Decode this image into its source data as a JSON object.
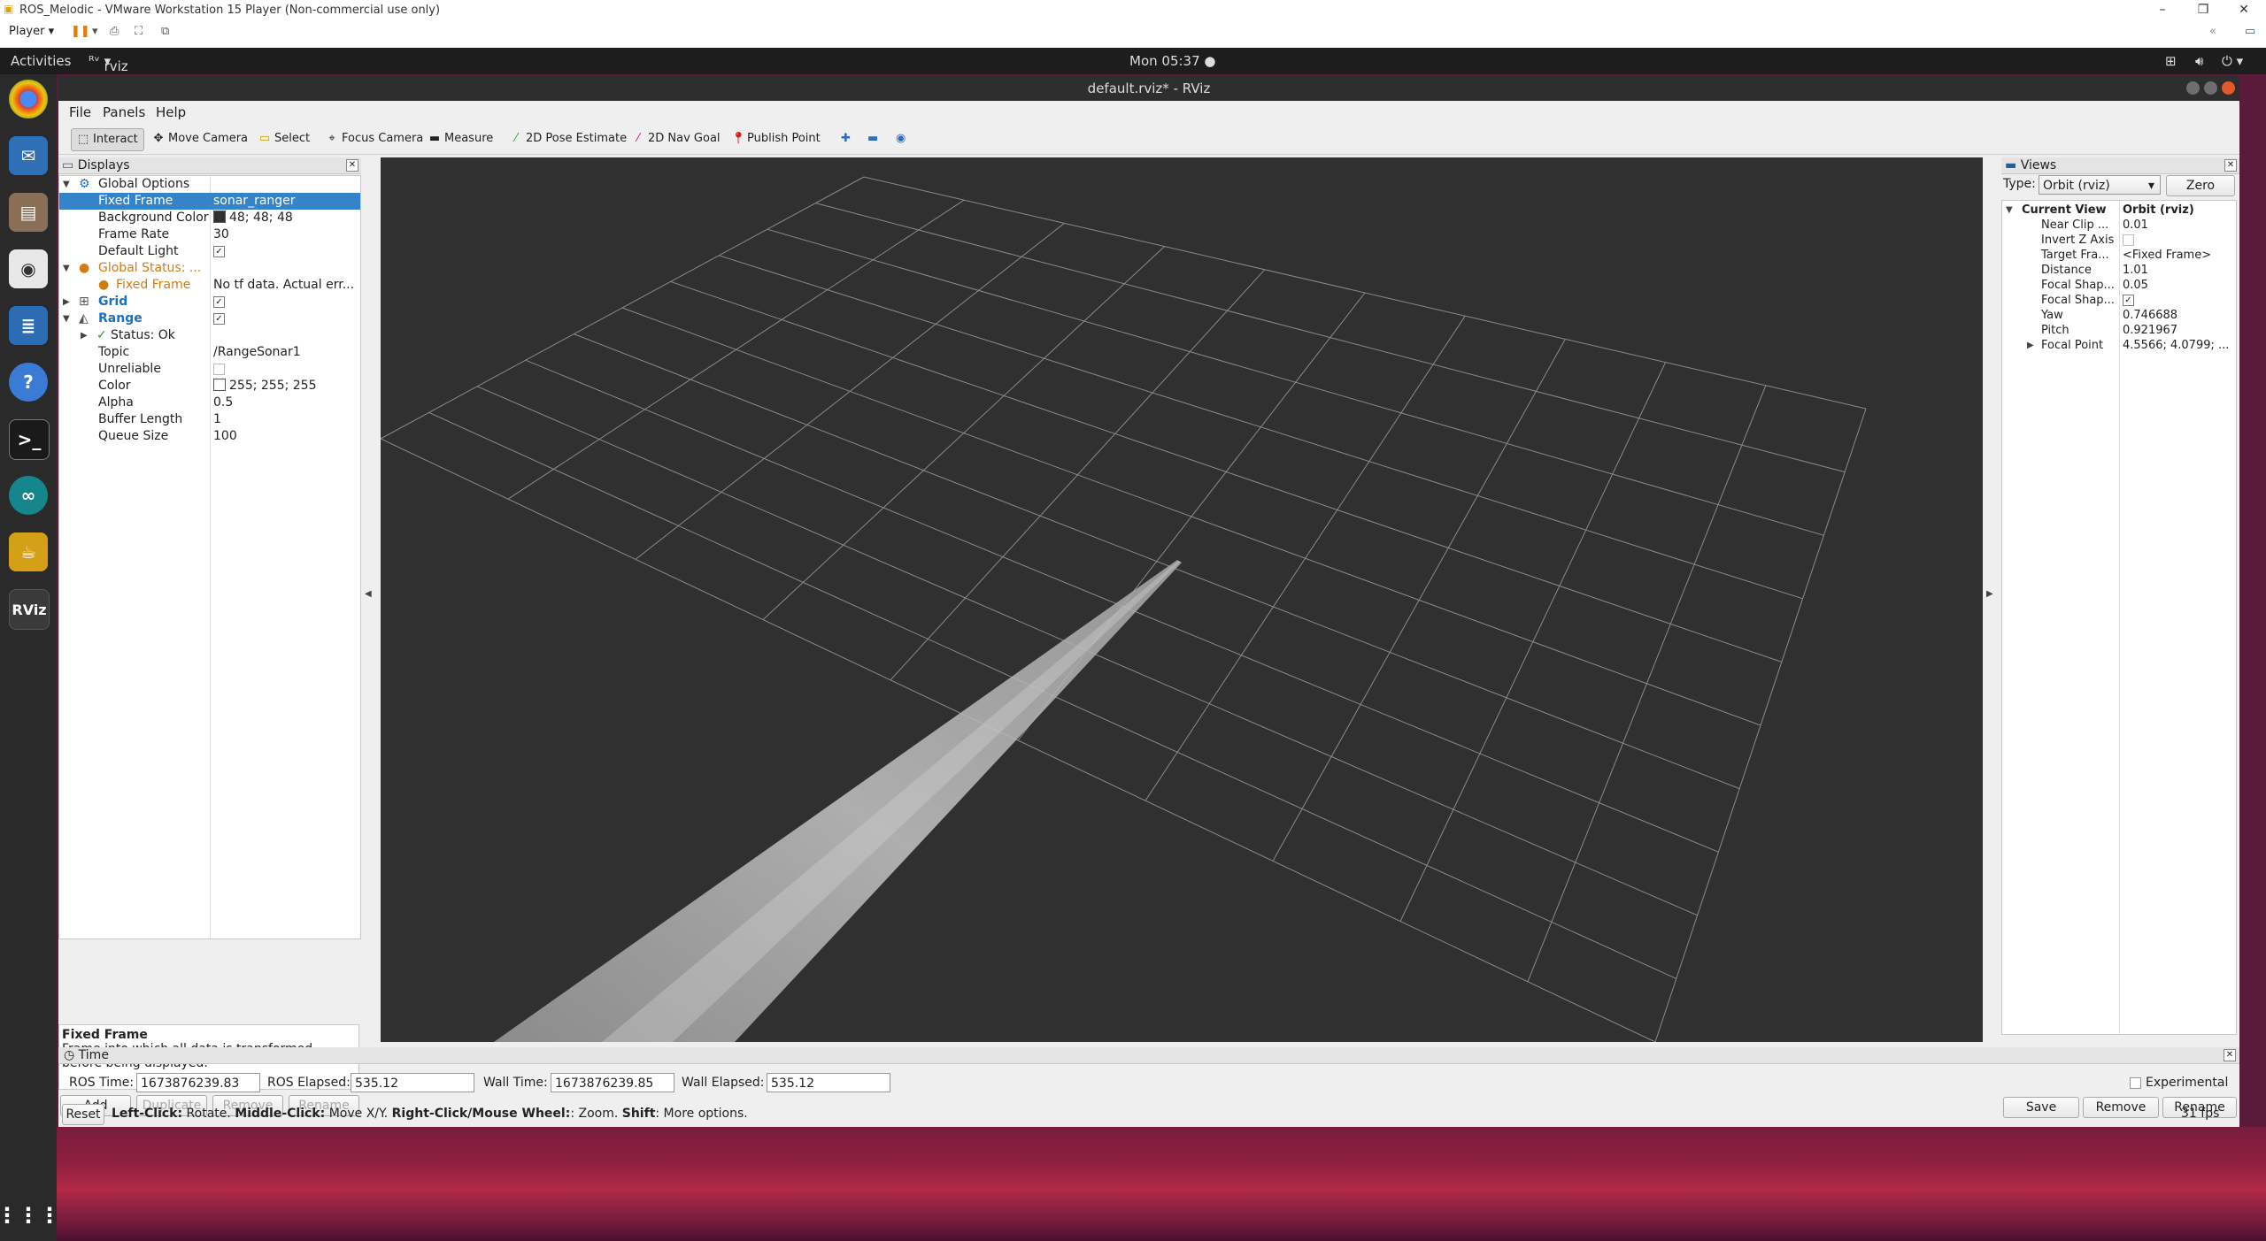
{
  "host": {
    "title": "ROS_Melodic - VMware Workstation 15 Player (Non-commercial use only)",
    "player_menu": "Player",
    "window_controls": [
      "–",
      "❐",
      "✕"
    ]
  },
  "gnome": {
    "activities": "Activities",
    "app_menu": "rviz",
    "clock": "Mon 05:37 ●"
  },
  "dock": {
    "apps": [
      "chrome-icon",
      "thunderbird-icon",
      "files-icon",
      "rhythmbox-icon",
      "writer-icon",
      "help-icon",
      "terminal-icon",
      "arduino-icon",
      "teapot-icon",
      "rviz-icon"
    ],
    "rviz_label": "RViz"
  },
  "rviz": {
    "window_title": "default.rviz* - RViz",
    "menu": {
      "file": "File",
      "panels": "Panels",
      "help": "Help"
    },
    "toolbar": {
      "interact": "Interact",
      "move_camera": "Move Camera",
      "select": "Select",
      "focus_camera": "Focus Camera",
      "measure": "Measure",
      "pose_estimate": "2D Pose Estimate",
      "nav_goal": "2D Nav Goal",
      "publish_point": "Publish Point"
    },
    "displays": {
      "title": "Displays",
      "rows": [
        {
          "key": "Global Options"
        },
        {
          "key": "Fixed Frame",
          "value": "sonar_ranger"
        },
        {
          "key": "Background Color",
          "value": "48; 48; 48"
        },
        {
          "key": "Frame Rate",
          "value": "30"
        },
        {
          "key": "Default Light"
        },
        {
          "key": "Global Status: ..."
        },
        {
          "key": "Fixed Frame",
          "value": "No tf data.  Actual err..."
        },
        {
          "key": "Grid"
        },
        {
          "key": "Range"
        },
        {
          "key": "Status: Ok"
        },
        {
          "key": "Topic",
          "value": "/RangeSonar1"
        },
        {
          "key": "Unreliable"
        },
        {
          "key": "Color",
          "value": "255; 255; 255"
        },
        {
          "key": "Alpha",
          "value": "0.5"
        },
        {
          "key": "Buffer Length",
          "value": "1"
        },
        {
          "key": "Queue Size",
          "value": "100"
        }
      ],
      "description_title": "Fixed Frame",
      "description_text": "Frame into which all data is transformed before being displayed.",
      "buttons": {
        "add": "Add",
        "duplicate": "Duplicate",
        "remove": "Remove",
        "rename": "Rename"
      }
    },
    "views": {
      "title": "Views",
      "type_label": "Type:",
      "type_value": "Orbit (rviz)",
      "zero": "Zero",
      "current_view": {
        "key": "Current View",
        "value": "Orbit (rviz)"
      },
      "rows": [
        {
          "key": "Near Clip ...",
          "value": "0.01"
        },
        {
          "key": "Invert Z Axis",
          "value": ""
        },
        {
          "key": "Target Fra...",
          "value": "<Fixed Frame>"
        },
        {
          "key": "Distance",
          "value": "1.01"
        },
        {
          "key": "Focal Shap...",
          "value": "0.05"
        },
        {
          "key": "Focal Shap...",
          "value": ""
        },
        {
          "key": "Yaw",
          "value": "0.746688"
        },
        {
          "key": "Pitch",
          "value": "0.921967"
        },
        {
          "key": "Focal Point",
          "value": "4.5566; 4.0799; ..."
        }
      ],
      "buttons": {
        "save": "Save",
        "remove": "Remove",
        "rename": "Rename"
      }
    },
    "time": {
      "title": "Time",
      "ros_time_label": "ROS Time:",
      "ros_time": "1673876239.83",
      "ros_elapsed_label": "ROS Elapsed:",
      "ros_elapsed": "535.12",
      "wall_time_label": "Wall Time:",
      "wall_time": "1673876239.85",
      "wall_elapsed_label": "Wall Elapsed:",
      "wall_elapsed": "535.12",
      "experimental": "Experimental"
    },
    "status": {
      "reset": "Reset",
      "hint_parts": [
        {
          "b": "Left-Click:",
          "t": " Rotate. "
        },
        {
          "b": "Middle-Click:",
          "t": " Move X/Y. "
        },
        {
          "b": "Right-Click/Mouse Wheel:",
          "t": ": Zoom. "
        },
        {
          "b": "Shift",
          "t": ": More options."
        }
      ],
      "fps": "31 fps"
    }
  }
}
